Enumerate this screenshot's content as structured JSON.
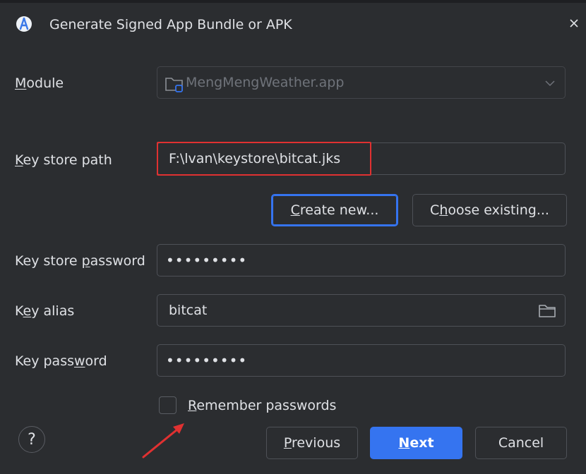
{
  "dialog": {
    "title": "Generate Signed App Bundle or APK",
    "close_icon": "close-icon",
    "app_icon": "android-studio-icon"
  },
  "module": {
    "label_pre": "",
    "label_u": "M",
    "label_post": "odule",
    "value": "MengMengWeather.app"
  },
  "keystore_path": {
    "label_pre": "",
    "label_u": "K",
    "label_post": "ey store path",
    "value": "F:\\lvan\\keystore\\bitcat.jks"
  },
  "buttons": {
    "create_pre": "",
    "create_u": "C",
    "create_post": "reate new...",
    "choose_pre": "C",
    "choose_u": "h",
    "choose_post": "oose existing...",
    "previous_pre": "",
    "previous_u": "P",
    "previous_post": "revious",
    "next_pre": "",
    "next_u": "N",
    "next_post": "ext",
    "cancel": "Cancel",
    "help": "?"
  },
  "keystore_password": {
    "label_pre": "Key store ",
    "label_u": "p",
    "label_post": "assword",
    "masked": "•••••••••"
  },
  "key_alias": {
    "label_pre": "K",
    "label_u": "e",
    "label_post": "y alias",
    "value": "bitcat"
  },
  "key_password": {
    "label_pre": "Key pass",
    "label_u": "w",
    "label_post": "ord",
    "masked": "•••••••••"
  },
  "remember": {
    "label_pre": "",
    "label_u": "R",
    "label_post": "emember passwords",
    "checked": false
  },
  "colors": {
    "accent": "#3574f0",
    "annotation_red": "#e03131",
    "background": "#2b2d30"
  }
}
